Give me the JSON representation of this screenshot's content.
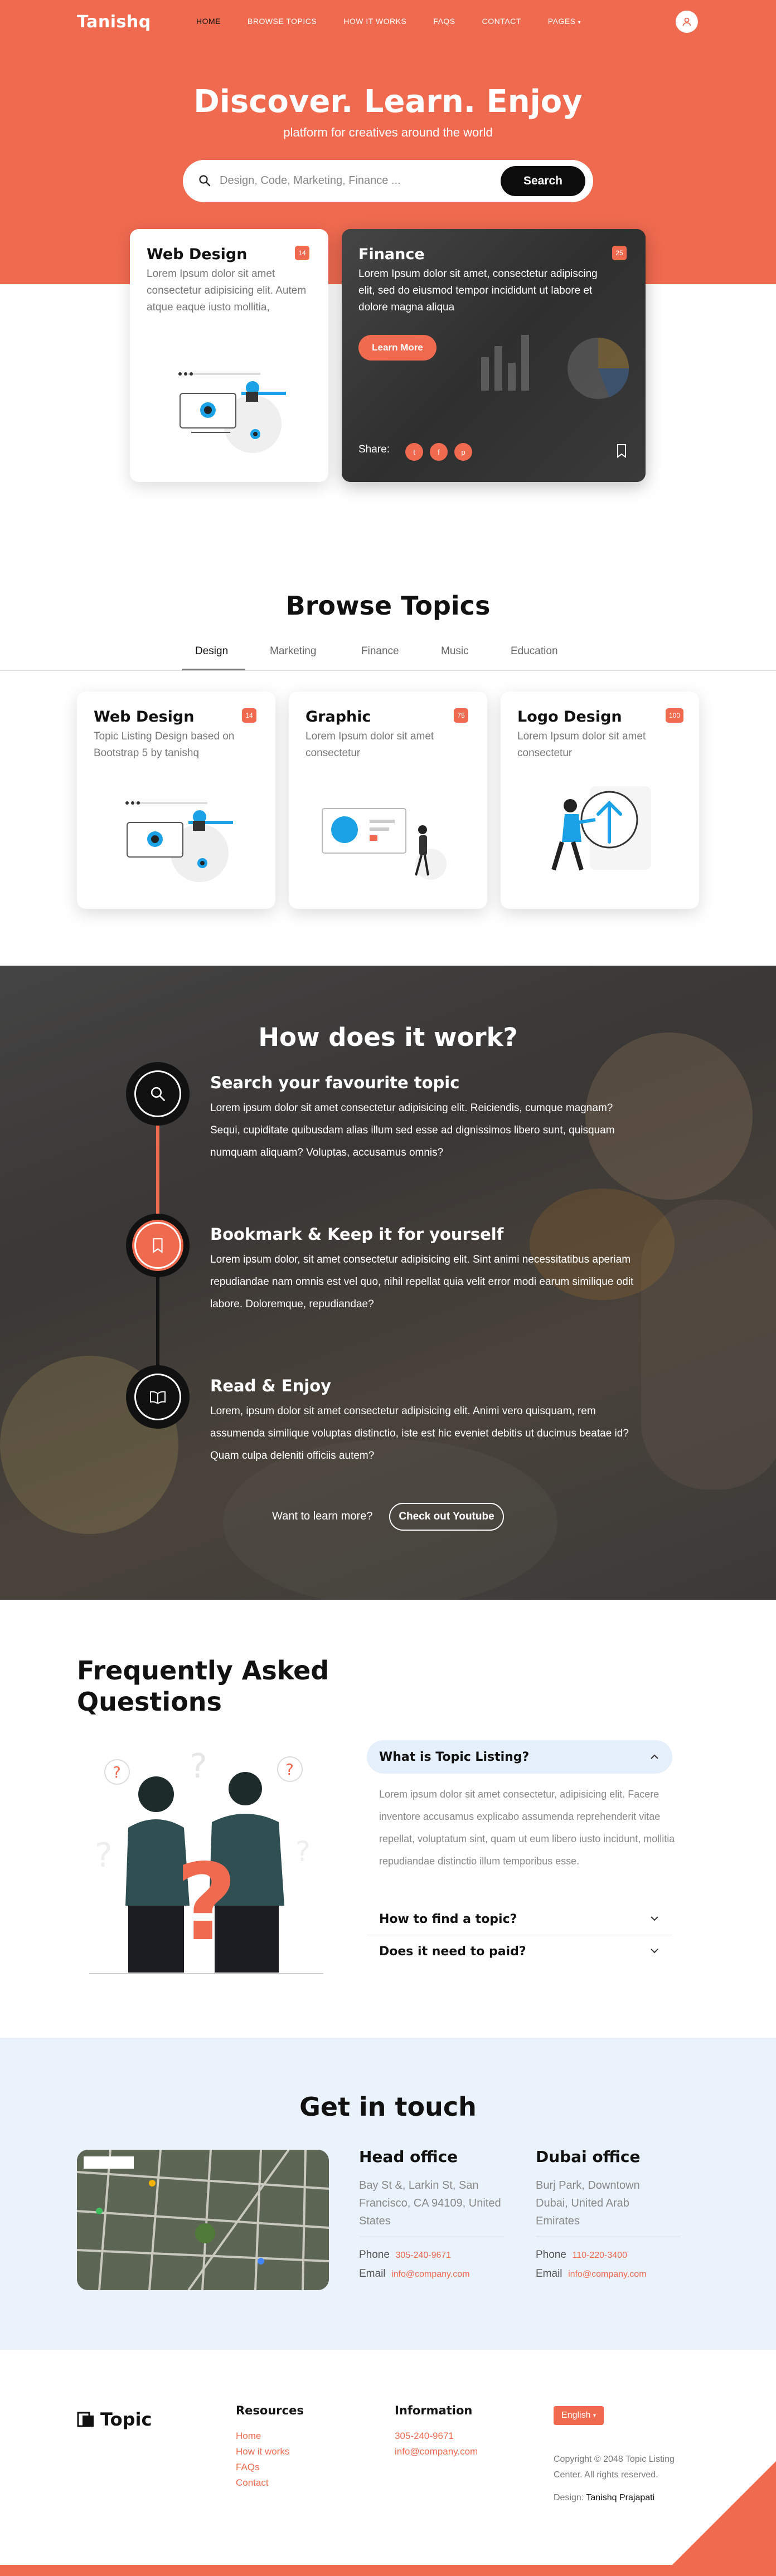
{
  "brand": "Tanishq",
  "nav": {
    "items": [
      "HOME",
      "BROWSE TOPICS",
      "HOW IT WORKS",
      "FAQS",
      "CONTACT",
      "PAGES"
    ],
    "active": "HOME"
  },
  "hero": {
    "title": "Discover. Learn. Enjoy",
    "subtitle": "platform for creatives around the world",
    "search_placeholder": "Design, Code, Marketing, Finance ...",
    "search_button": "Search"
  },
  "featured": {
    "web": {
      "title": "Web Design",
      "badge": "14",
      "text": "Lorem Ipsum dolor sit amet consectetur adipisicing elit. Autem atque eaque iusto mollitia,"
    },
    "finance": {
      "title": "Finance",
      "badge": "25",
      "text": "Lorem Ipsum dolor sit amet, consectetur adipiscing elit, sed do eiusmod tempor incididunt ut labore et dolore magna aliqua",
      "button": "Learn More",
      "share_label": "Share:"
    }
  },
  "browse": {
    "title": "Browse Topics",
    "tabs": [
      "Design",
      "Marketing",
      "Finance",
      "Music",
      "Education"
    ],
    "active_tab": "Design",
    "cards": [
      {
        "title": "Web Design",
        "badge": "14",
        "text": "Topic Listing Design based on Bootstrap 5 by tanishq"
      },
      {
        "title": "Graphic",
        "badge": "75",
        "text": "Lorem Ipsum dolor sit amet consectetur"
      },
      {
        "title": "Logo Design",
        "badge": "100",
        "text": "Lorem Ipsum dolor sit amet consectetur"
      }
    ]
  },
  "how": {
    "title": "How does it work?",
    "steps": [
      {
        "title": "Search your favourite topic",
        "text": "Lorem ipsum dolor sit amet consectetur adipisicing elit. Reiciendis, cumque magnam? Sequi, cupiditate quibusdam alias illum sed esse ad dignissimos libero sunt, quisquam numquam aliquam? Voluptas, accusamus omnis?"
      },
      {
        "title": "Bookmark & Keep it for yourself",
        "text": "Lorem ipsum dolor, sit amet consectetur adipisicing elit. Sint animi necessitatibus aperiam repudiandae nam omnis est vel quo, nihil repellat quia velit error modi earum similique odit labore. Doloremque, repudiandae?"
      },
      {
        "title": "Read & Enjoy",
        "text": "Lorem, ipsum dolor sit amet consectetur adipisicing elit. Animi vero quisquam, rem assumenda similique voluptas distinctio, iste est hic eveniet debitis ut ducimus beatae id? Quam culpa deleniti officiis autem?"
      }
    ],
    "learn_text": "Want to learn more?",
    "youtube_button": "Check out Youtube"
  },
  "faq": {
    "title": "Frequently Asked Questions",
    "items": [
      {
        "q": "What is Topic Listing?",
        "a": "Lorem ipsum dolor sit amet consectetur, adipisicing elit. Facere inventore accusamus explicabo assumenda reprehenderit vitae repellat, voluptatum sint, quam ut eum libero iusto incidunt, mollitia repudiandae distinctio illum temporibus esse.",
        "open": true
      },
      {
        "q": "How to find a topic?",
        "open": false
      },
      {
        "q": "Does it need to paid?",
        "open": false
      }
    ]
  },
  "contact": {
    "title": "Get in touch",
    "offices": [
      {
        "name": "Head office",
        "address": "Bay St &, Larkin St, San Francisco, CA 94109, United States",
        "phone_label": "Phone",
        "phone": "305-240-9671",
        "email_label": "Email",
        "email": "info@company.com"
      },
      {
        "name": "Dubai office",
        "address": "Burj Park, Downtown Dubai, United Arab Emirates",
        "phone_label": "Phone",
        "phone": "110-220-3400",
        "email_label": "Email",
        "email": "info@company.com"
      }
    ]
  },
  "footer": {
    "logo": "Topic",
    "resources_title": "Resources",
    "resources": [
      "Home",
      "How it works",
      "FAQs",
      "Contact"
    ],
    "information_title": "Information",
    "information": [
      "305-240-9671",
      "info@company.com"
    ],
    "language": "English",
    "copyright": "Copyright © 2048 Topic Listing Center. All rights reserved.",
    "design_label": "Design:",
    "designer": "Tanishq Prajapati"
  },
  "colors": {
    "accent": "#ef6a4f",
    "dark": "#111111",
    "light_blue": "#eaf2fc"
  }
}
